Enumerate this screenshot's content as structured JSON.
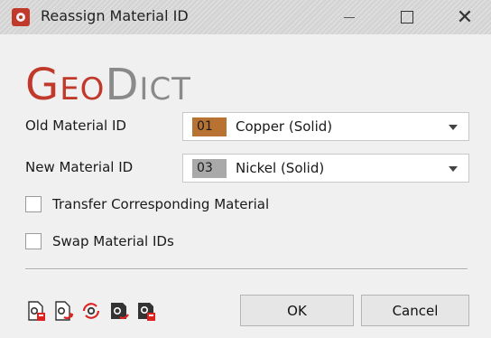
{
  "window": {
    "title": "Reassign Material ID"
  },
  "logo": {
    "part1": "Geo",
    "part2": "Dict"
  },
  "old_material": {
    "label": "Old Material ID",
    "id": "01",
    "name": "Copper (Solid)",
    "color": "#b87333"
  },
  "new_material": {
    "label": "New Material ID",
    "id": "03",
    "name": "Nickel (Solid)",
    "color": "#a9a9a9"
  },
  "options": {
    "transfer": {
      "label": "Transfer Corresponding Material",
      "checked": false
    },
    "swap": {
      "label": "Swap Material IDs",
      "checked": false
    }
  },
  "toolbar_icons": [
    "save-settings-icon",
    "load-settings-icon",
    "reset-icon",
    "save-macro-icon",
    "load-macro-icon"
  ],
  "buttons": {
    "ok": "OK",
    "cancel": "Cancel"
  },
  "colors": {
    "brand_red": "#c0392b",
    "logo_gray": "#8a8a8a"
  }
}
